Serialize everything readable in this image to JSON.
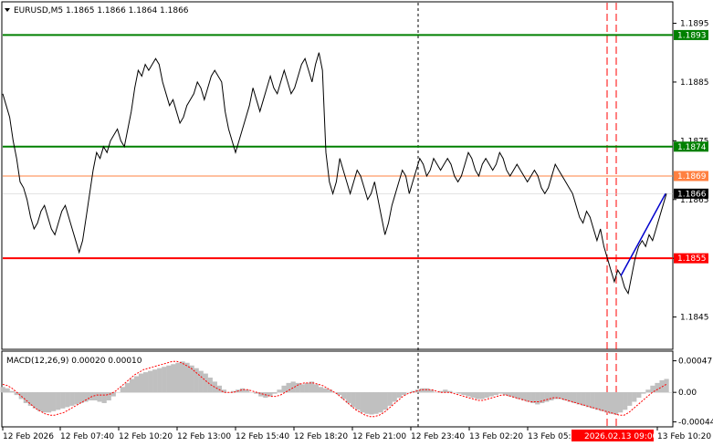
{
  "header": {
    "title": "EURUSD,M5  1.1865 1.1866 1.1864 1.1866",
    "indicator_label": "MACD(12,26,9) 0.00020 0.00010",
    "menu_arrow": "triangle-down-icon"
  },
  "colors": {
    "background": "#ffffff",
    "price_line": "#000000",
    "level_green": "#008000",
    "level_orange": "#ff8040",
    "level_red": "#ff0000",
    "trend_blue": "#0000cd",
    "macd_hist": "#c0c0c0",
    "macd_signal": "#ff0000",
    "badge_current": "#000000"
  },
  "price_axis": {
    "ticks": [
      "1.1895",
      "1.1885",
      "1.1875",
      "1.1865",
      "1.1855",
      "1.1845"
    ],
    "tick_values": [
      1.1895,
      1.1885,
      1.1875,
      1.1865,
      1.1855,
      1.1845
    ],
    "range": [
      1.18395,
      1.18985
    ]
  },
  "levels": [
    {
      "name": "resistance-top",
      "value": 1.1893,
      "label": "1.1893",
      "color": "#008000"
    },
    {
      "name": "resistance-mid",
      "value": 1.1874,
      "label": "1.1874",
      "color": "#008000"
    },
    {
      "name": "target-orange",
      "value": 1.1869,
      "label": "1.1869",
      "color": "#ff8040"
    },
    {
      "name": "support-red",
      "value": 1.1855,
      "label": "1.1855",
      "color": "#ff0000"
    }
  ],
  "current_price": {
    "value": 1.1866,
    "label": "1.1866"
  },
  "macd_axis": {
    "ticks": [
      "0.00047",
      "0.00",
      "-0.00044"
    ],
    "tick_values": [
      0.00047,
      0.0,
      -0.00044
    ],
    "range": [
      -0.0005,
      0.0006
    ]
  },
  "time_axis": {
    "labels": [
      "12 Feb 2026",
      "12 Feb 07:40",
      "12 Feb 10:20",
      "12 Feb 13:00",
      "12 Feb 15:40",
      "12 Feb 18:20",
      "12 Feb 21:00",
      "12 Feb 23:40",
      "13 Feb 02:20",
      "13 Feb 05:00",
      "13 Feb 10:20"
    ],
    "highlight_label": "2026.02.13 09:00"
  },
  "chart_data": {
    "type": "line",
    "title": "EURUSD,M5",
    "price_series": [
      1.1883,
      1.1881,
      1.1879,
      1.1875,
      1.1872,
      1.1868,
      1.1867,
      1.1865,
      1.1862,
      1.186,
      1.1861,
      1.1863,
      1.1864,
      1.1862,
      1.186,
      1.1859,
      1.1861,
      1.1863,
      1.1864,
      1.1862,
      1.186,
      1.1858,
      1.1856,
      1.1858,
      1.1862,
      1.1866,
      1.187,
      1.1873,
      1.1872,
      1.1874,
      1.1873,
      1.1875,
      1.1876,
      1.1877,
      1.1875,
      1.1874,
      1.1877,
      1.188,
      1.1884,
      1.1887,
      1.1886,
      1.1888,
      1.1887,
      1.1888,
      1.1889,
      1.1888,
      1.1885,
      1.1883,
      1.1881,
      1.1882,
      1.188,
      1.1878,
      1.1879,
      1.1881,
      1.1882,
      1.1883,
      1.1885,
      1.1884,
      1.1882,
      1.1884,
      1.1886,
      1.1887,
      1.1886,
      1.1885,
      1.188,
      1.1877,
      1.1875,
      1.1873,
      1.1875,
      1.1877,
      1.1879,
      1.1881,
      1.1884,
      1.1882,
      1.188,
      1.1882,
      1.1884,
      1.1886,
      1.1884,
      1.1883,
      1.1885,
      1.1887,
      1.1885,
      1.1883,
      1.1884,
      1.1886,
      1.1888,
      1.1889,
      1.1887,
      1.1885,
      1.1888,
      1.189,
      1.1887,
      1.1873,
      1.1868,
      1.1866,
      1.1868,
      1.1872,
      1.187,
      1.1868,
      1.1866,
      1.1868,
      1.187,
      1.1869,
      1.1867,
      1.1865,
      1.1866,
      1.1868,
      1.1865,
      1.1862,
      1.1859,
      1.1861,
      1.1864,
      1.1866,
      1.1868,
      1.187,
      1.1869,
      1.1866,
      1.1868,
      1.187,
      1.1872,
      1.1871,
      1.1869,
      1.187,
      1.1872,
      1.1871,
      1.187,
      1.1871,
      1.1872,
      1.1871,
      1.1869,
      1.1868,
      1.1869,
      1.1871,
      1.1873,
      1.1872,
      1.187,
      1.1869,
      1.1871,
      1.1872,
      1.1871,
      1.187,
      1.1871,
      1.1873,
      1.1872,
      1.187,
      1.1869,
      1.187,
      1.1871,
      1.187,
      1.1869,
      1.1868,
      1.1869,
      1.187,
      1.1869,
      1.1867,
      1.1866,
      1.1867,
      1.1869,
      1.1871,
      1.187,
      1.1869,
      1.1868,
      1.1867,
      1.1866,
      1.1864,
      1.1862,
      1.1861,
      1.1863,
      1.1862,
      1.186,
      1.1858,
      1.186,
      1.1857,
      1.1855,
      1.1853,
      1.1851,
      1.1853,
      1.1852,
      1.185,
      1.1849,
      1.1852,
      1.1855,
      1.1857,
      1.1858,
      1.1857,
      1.1859,
      1.1858,
      1.186,
      1.1862,
      1.1864,
      1.1866
    ],
    "macd_hist": [
      8e-05,
      6e-05,
      2e-05,
      -4e-05,
      -0.0001,
      -0.00016,
      -0.0002,
      -0.00024,
      -0.00028,
      -0.0003,
      -0.0003,
      -0.00028,
      -0.00026,
      -0.00024,
      -0.00022,
      -0.0002,
      -0.00018,
      -0.00016,
      -0.00014,
      -0.00012,
      -0.00012,
      -0.00014,
      -0.00016,
      -0.00012,
      -6e-05,
      0.0,
      8e-05,
      0.00014,
      0.0002,
      0.00024,
      0.00028,
      0.0003,
      0.00032,
      0.00034,
      0.00036,
      0.00038,
      0.0004,
      0.00042,
      0.00044,
      0.00046,
      0.00044,
      0.0004,
      0.00036,
      0.00032,
      0.00028,
      0.00022,
      0.00016,
      0.0001,
      4e-05,
      0.0,
      2e-05,
      4e-05,
      6e-05,
      4e-05,
      0.0,
      -2e-05,
      -6e-05,
      -8e-05,
      -6e-05,
      -2e-05,
      4e-05,
      0.0001,
      0.00014,
      0.00016,
      0.00014,
      0.00012,
      0.00014,
      0.00016,
      0.00012,
      8e-05,
      6e-05,
      4e-05,
      0.0,
      -4e-05,
      -0.0001,
      -0.00016,
      -0.00022,
      -0.00026,
      -0.0003,
      -0.00032,
      -0.00033,
      -0.00032,
      -0.0003,
      -0.00026,
      -0.0002,
      -0.00014,
      -8e-05,
      -4e-05,
      0.0,
      2e-05,
      4e-05,
      6e-05,
      6e-05,
      4e-05,
      0.0,
      2e-05,
      4e-05,
      2e-05,
      0.0,
      -2e-05,
      -4e-05,
      -6e-05,
      -8e-05,
      -0.0001,
      -0.0001,
      -8e-05,
      -6e-05,
      -4e-05,
      -2e-05,
      -4e-05,
      -6e-05,
      -8e-05,
      -0.0001,
      -0.00012,
      -0.00014,
      -0.00016,
      -0.00018,
      -0.00016,
      -0.00014,
      -0.00012,
      -0.0001,
      -0.0001,
      -0.00012,
      -0.00014,
      -0.00016,
      -0.00018,
      -0.0002,
      -0.00022,
      -0.00024,
      -0.00026,
      -0.00028,
      -0.0003,
      -0.00032,
      -0.00033,
      -0.0003,
      -0.00026,
      -0.0002,
      -0.00014,
      -8e-05,
      -2e-05,
      4e-05,
      0.0001,
      0.00014,
      0.00018,
      0.0002
    ],
    "macd_signal": [
      0.00012,
      0.0001,
      6e-05,
      0.0,
      -6e-05,
      -0.00012,
      -0.00018,
      -0.00024,
      -0.00028,
      -0.00032,
      -0.00034,
      -0.00034,
      -0.00032,
      -0.0003,
      -0.00026,
      -0.00022,
      -0.00018,
      -0.00014,
      -0.0001,
      -6e-05,
      -4e-05,
      -4e-05,
      -4e-05,
      -2e-05,
      2e-05,
      8e-05,
      0.00014,
      0.0002,
      0.00026,
      0.0003,
      0.00034,
      0.00036,
      0.00038,
      0.0004,
      0.00042,
      0.00044,
      0.00046,
      0.00046,
      0.00044,
      0.0004,
      0.00036,
      0.0003,
      0.00024,
      0.00018,
      0.00012,
      8e-05,
      4e-05,
      0.0,
      0.0,
      0.0,
      2e-05,
      4e-05,
      4e-05,
      2e-05,
      0.0,
      -2e-05,
      -4e-05,
      -6e-05,
      -6e-05,
      -4e-05,
      0.0,
      4e-05,
      8e-05,
      0.00012,
      0.00014,
      0.00014,
      0.00014,
      0.00012,
      0.0001,
      6e-05,
      2e-05,
      -2e-05,
      -8e-05,
      -0.00014,
      -0.0002,
      -0.00026,
      -0.0003,
      -0.00034,
      -0.00036,
      -0.00036,
      -0.00034,
      -0.0003,
      -0.00024,
      -0.00018,
      -0.00012,
      -6e-05,
      -2e-05,
      0.0,
      2e-05,
      4e-05,
      4e-05,
      4e-05,
      2e-05,
      0.0,
      0.0,
      0.0,
      -2e-05,
      -4e-05,
      -6e-05,
      -8e-05,
      -0.0001,
      -0.00012,
      -0.00012,
      -0.0001,
      -8e-05,
      -6e-05,
      -4e-05,
      -4e-05,
      -6e-05,
      -8e-05,
      -0.0001,
      -0.00012,
      -0.00014,
      -0.00014,
      -0.00014,
      -0.00012,
      -0.0001,
      -8e-05,
      -8e-05,
      -0.0001,
      -0.00012,
      -0.00014,
      -0.00016,
      -0.00018,
      -0.0002,
      -0.00022,
      -0.00024,
      -0.00026,
      -0.00028,
      -0.0003,
      -0.00032,
      -0.00034,
      -0.00034,
      -0.0003,
      -0.00024,
      -0.00018,
      -0.00012,
      -6e-05,
      0.0,
      4e-05,
      8e-05,
      0.00012
    ],
    "trend_line": {
      "from": 1.1852,
      "to": 1.1866
    },
    "ylim": [
      1.18395,
      1.18985
    ],
    "grid": false
  }
}
